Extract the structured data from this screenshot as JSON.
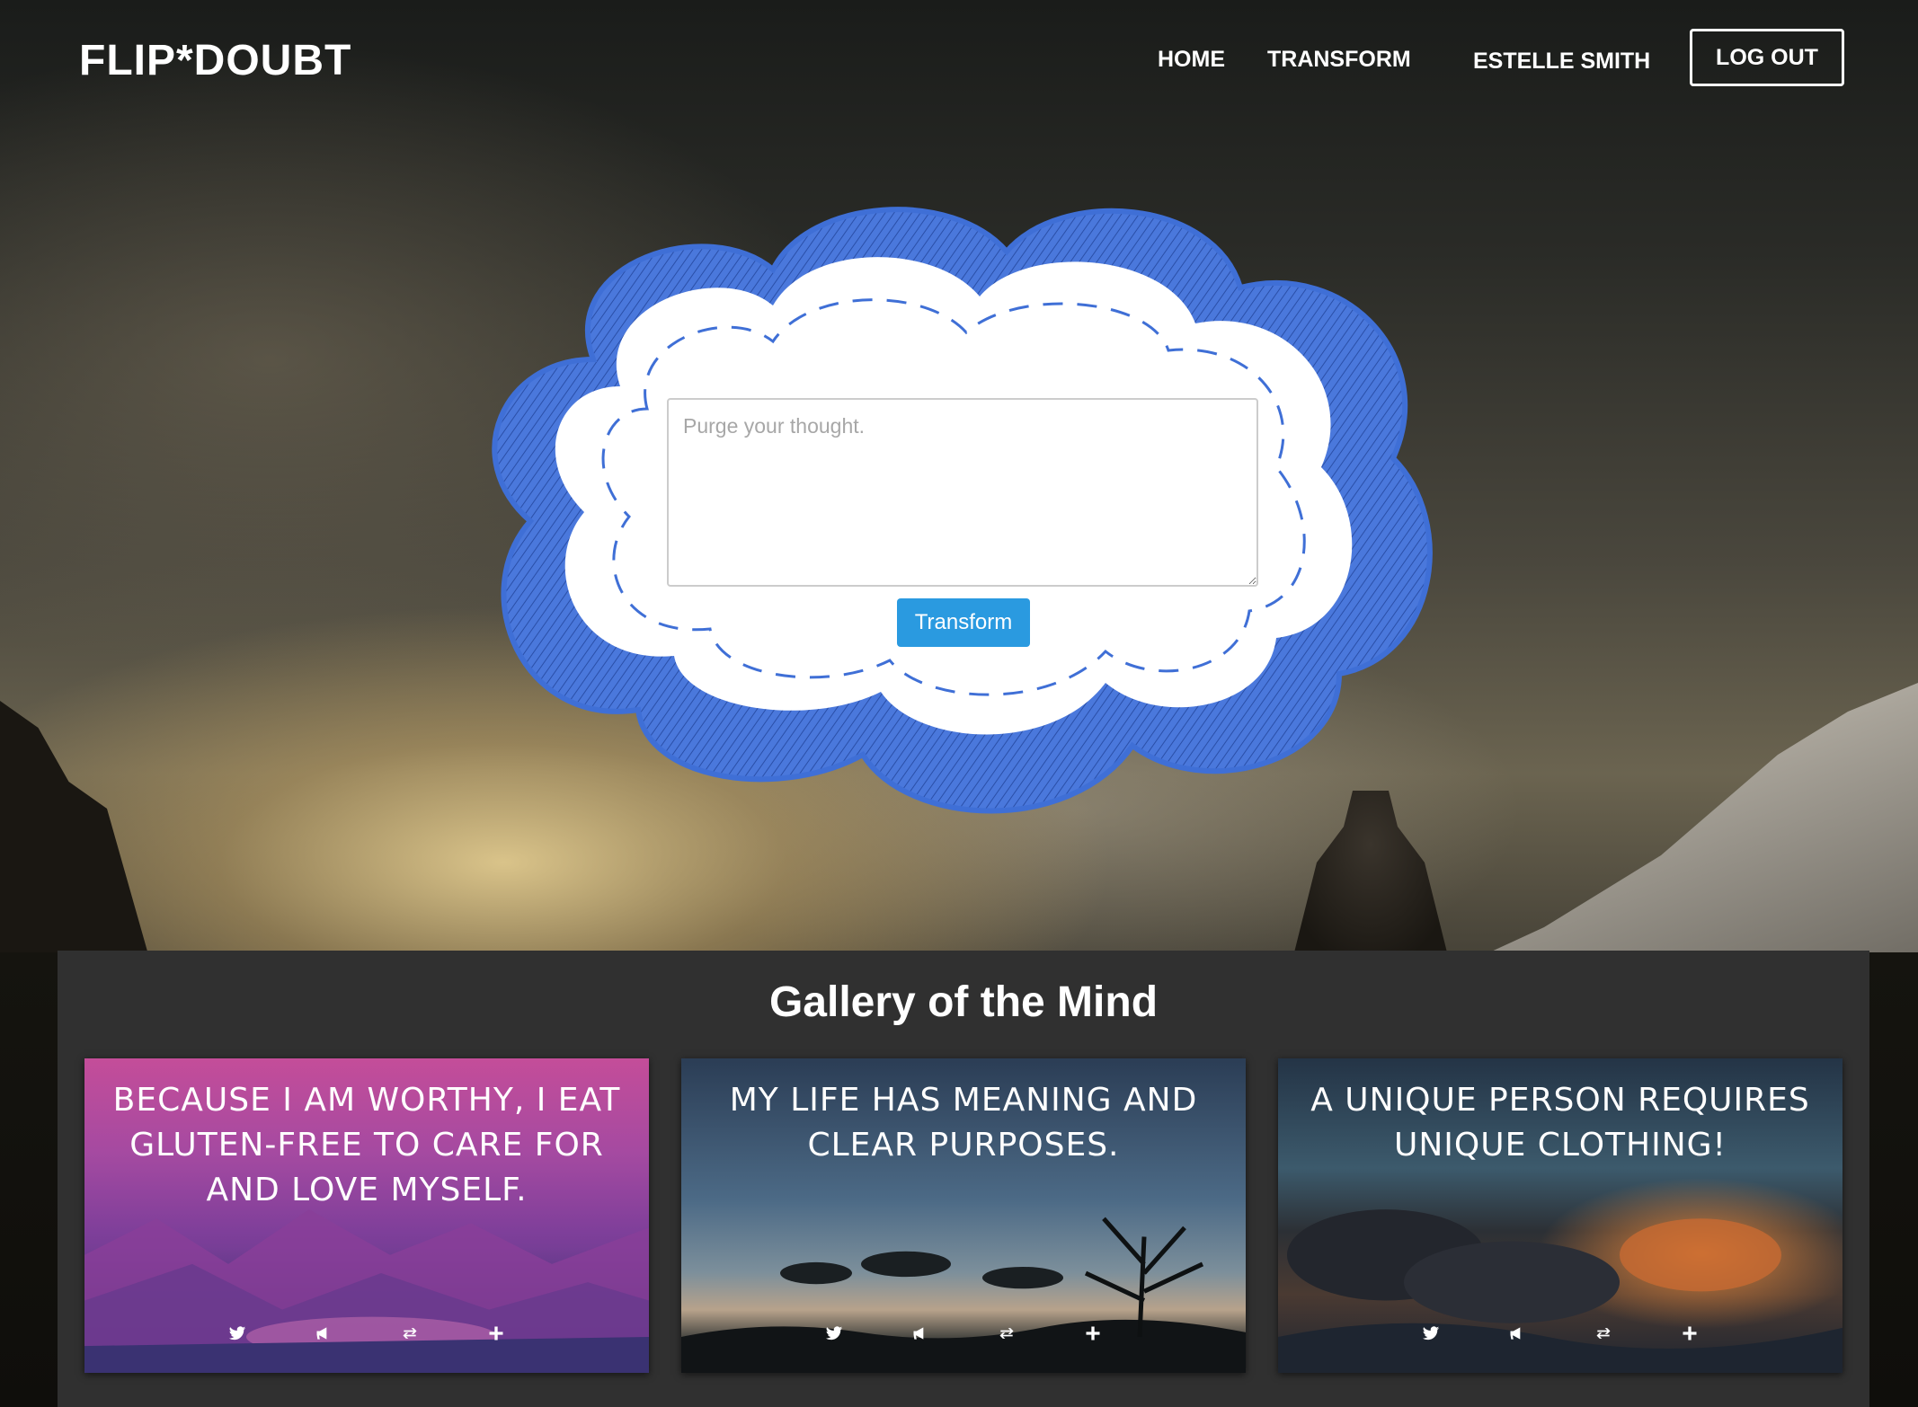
{
  "header": {
    "logo": "FLIP*DOUBT",
    "nav": {
      "home": "HOME",
      "transform": "TRANSFORM",
      "user": "ESTELLE SMITH",
      "logout": "LOG OUT"
    }
  },
  "thought_form": {
    "placeholder": "Purge your thought.",
    "value": "",
    "submit_label": "Transform"
  },
  "gallery": {
    "title": "Gallery of the Mind",
    "cards": [
      {
        "text": "Because I am worthy, I eat gluten-free to care for and love myself.",
        "icons": [
          "twitter-icon",
          "bullhorn-icon",
          "retweet-icon",
          "plus-icon"
        ]
      },
      {
        "text": "My life has meaning and clear purposes.",
        "icons": [
          "twitter-icon",
          "bullhorn-icon",
          "retweet-icon",
          "plus-icon"
        ]
      },
      {
        "text": "A unique person requires unique clothing!",
        "icons": [
          "twitter-icon",
          "bullhorn-icon",
          "retweet-icon",
          "plus-icon"
        ]
      }
    ]
  },
  "colors": {
    "accent_button": "#2a9ae0",
    "cloud_outline": "#3f6fd6",
    "gallery_bg": "#303030"
  }
}
